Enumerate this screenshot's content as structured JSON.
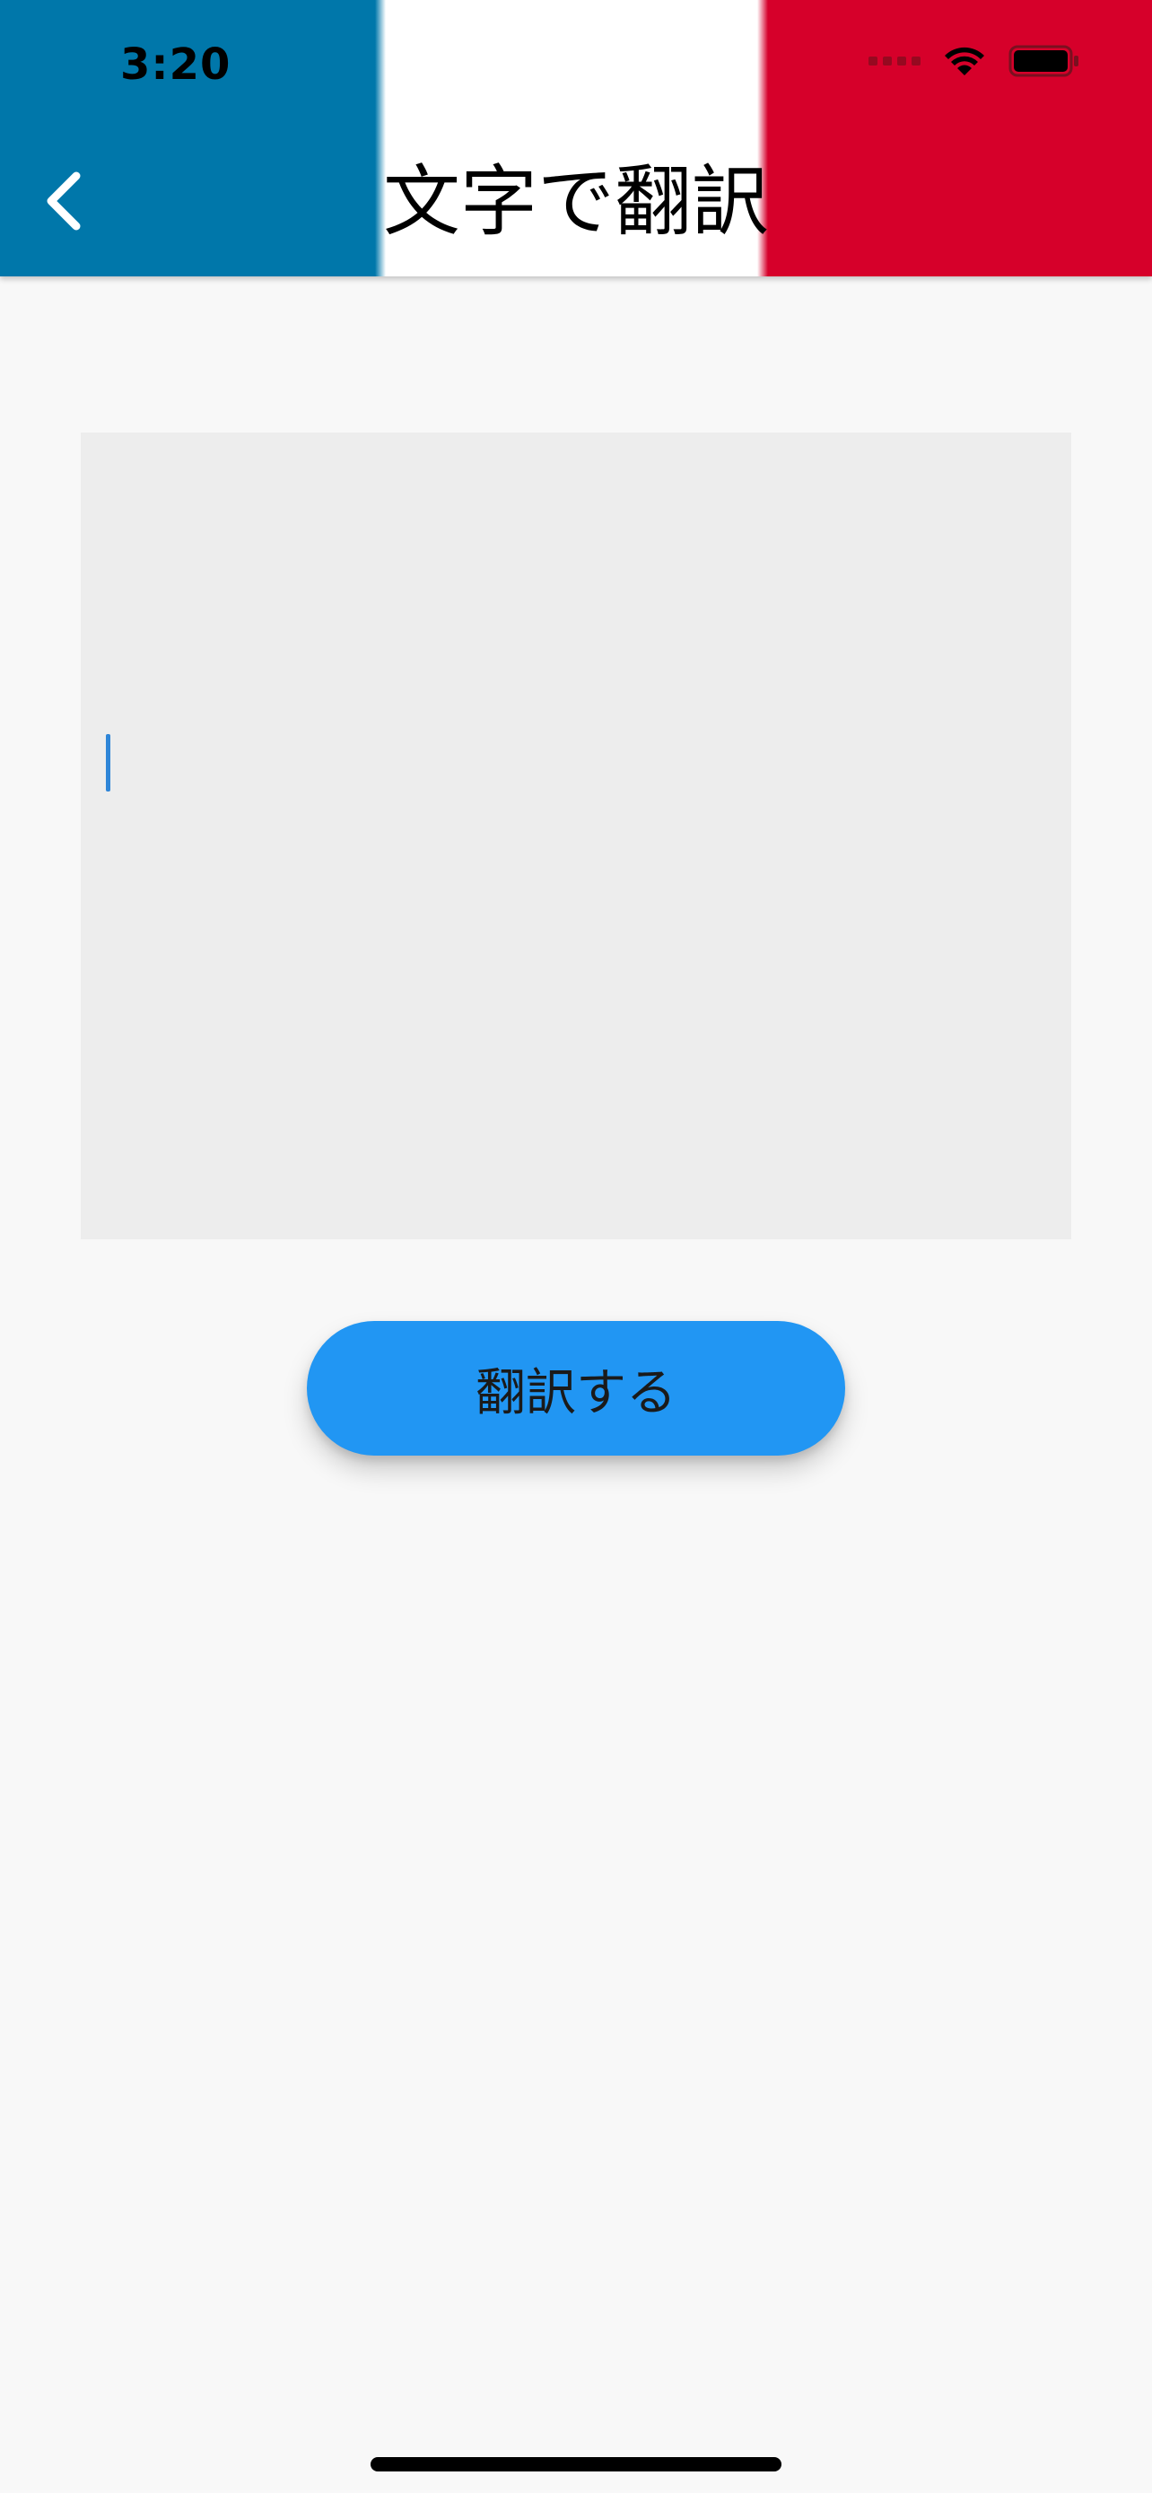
{
  "status_bar": {
    "time": "3:20",
    "icons": [
      "signal-icon",
      "wifi-icon",
      "battery-icon"
    ]
  },
  "header": {
    "title": "文字で翻訳",
    "back_icon": "chevron-left-icon",
    "colors": {
      "blue": "#0077aa",
      "white": "#ffffff",
      "red": "#d6002a"
    }
  },
  "input": {
    "value": "",
    "placeholder": ""
  },
  "actions": {
    "translate_label": "翻訳する",
    "button_color": "#2196f3"
  }
}
